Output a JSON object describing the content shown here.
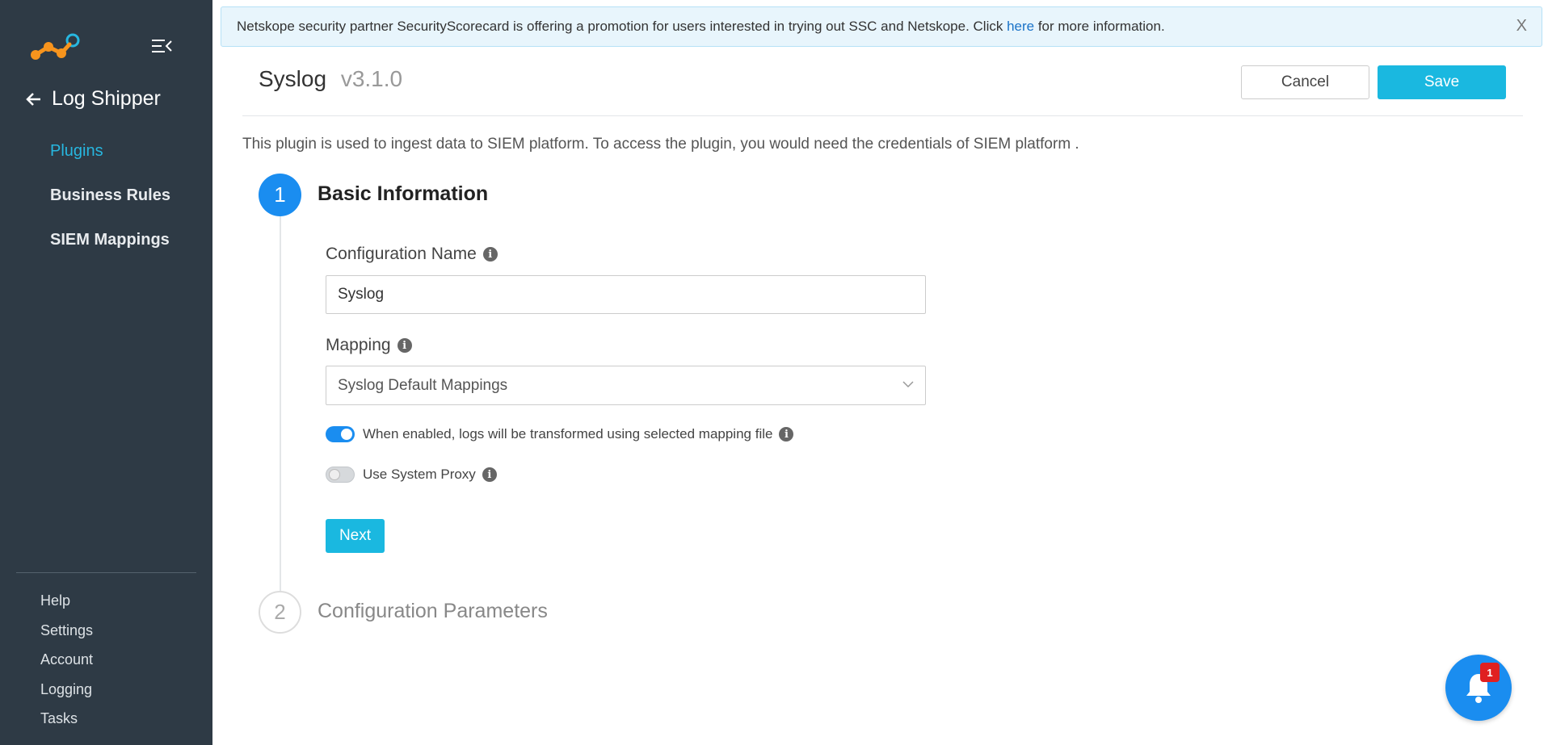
{
  "sidebar": {
    "back_title": "Log Shipper",
    "items": [
      {
        "label": "Plugins",
        "active": true
      },
      {
        "label": "Business Rules"
      },
      {
        "label": "SIEM Mappings"
      }
    ],
    "bottom_items": [
      {
        "label": "Help"
      },
      {
        "label": "Settings"
      },
      {
        "label": "Account"
      },
      {
        "label": "Logging"
      },
      {
        "label": "Tasks"
      }
    ]
  },
  "banner": {
    "text_before": "Netskope security partner SecurityScorecard is offering a promotion for users interested in trying out SSC and Netskope. Click ",
    "link": "here",
    "text_after": " for more information.",
    "close": "X"
  },
  "header": {
    "title": "Syslog",
    "version": "v3.1.0",
    "cancel_label": "Cancel",
    "save_label": "Save"
  },
  "description": "This plugin is used to ingest data to SIEM platform. To access the plugin, you would need the credentials of SIEM platform .",
  "steps": [
    {
      "number": "1",
      "title": "Basic Information"
    },
    {
      "number": "2",
      "title": "Configuration Parameters"
    }
  ],
  "form": {
    "config_name_label": "Configuration Name",
    "config_name_value": "Syslog",
    "mapping_label": "Mapping",
    "mapping_value": "Syslog Default Mappings",
    "transform_toggle_label": "When enabled, logs will be transformed using selected mapping file",
    "transform_toggle_on": true,
    "proxy_toggle_label": "Use System Proxy",
    "proxy_toggle_on": false,
    "next_label": "Next"
  },
  "notifications": {
    "count": "1"
  },
  "colors": {
    "sidebar": "#2e3a45",
    "accent": "#1ab8e0",
    "primary": "#1a8df0",
    "badge": "#e02020"
  }
}
